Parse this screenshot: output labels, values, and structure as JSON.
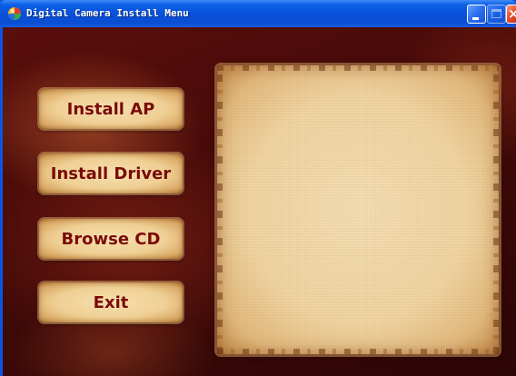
{
  "window": {
    "title": "Digital Camera Install Menu",
    "app_icon": "colorful-ball-icon",
    "controls": {
      "minimize_icon": "minimize-icon",
      "maximize_icon": "maximize-icon",
      "close_icon": "close-icon"
    },
    "colors": {
      "titlebar": "#0a56e0",
      "background": "#4a0b09",
      "button_text": "#7a0a06",
      "parchment": "#efd4a2"
    }
  },
  "menu": {
    "buttons": [
      {
        "label": "Install AP"
      },
      {
        "label": "Install Driver"
      },
      {
        "label": "Browse CD"
      },
      {
        "label": "Exit"
      }
    ]
  }
}
